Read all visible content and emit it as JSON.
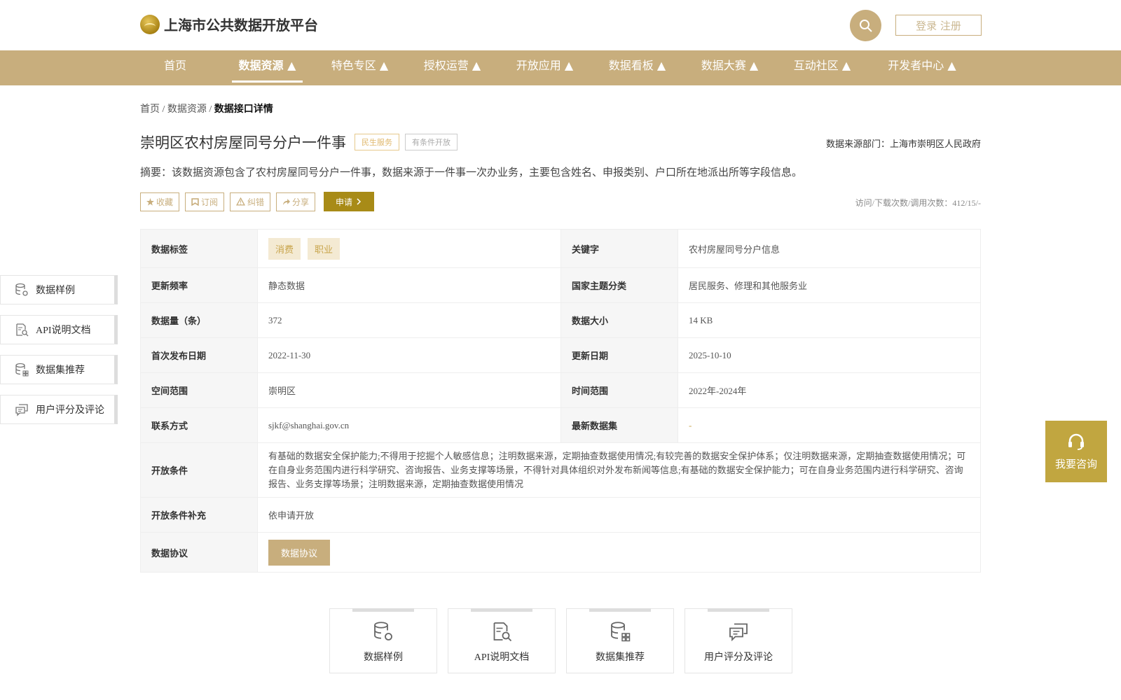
{
  "header": {
    "site_title": "上海市公共数据开放平台",
    "login_label": "登录 注册"
  },
  "nav": {
    "items": [
      {
        "label": "首页"
      },
      {
        "label": "数据资源 ▲"
      },
      {
        "label": "特色专区 ▲"
      },
      {
        "label": "授权运营 ▲"
      },
      {
        "label": "开放应用 ▲"
      },
      {
        "label": "数据看板 ▲"
      },
      {
        "label": "数据大赛 ▲"
      },
      {
        "label": "互动社区 ▲"
      },
      {
        "label": "开发者中心 ▲"
      }
    ],
    "active": "数据资源 ▲"
  },
  "breadcrumb": {
    "home": "首页",
    "sep1": " / ",
    "resources": "数据资源",
    "sep2": " / ",
    "current": "数据接口详情"
  },
  "detail": {
    "title": "崇明区农村房屋同号分户一件事",
    "tag_service": "民生服务",
    "tag_condition": "有条件开放",
    "source": "数据来源部门：上海市崇明区人民政府",
    "abstract": "摘要：该数据资源包含了农村房屋同号分户一件事，数据来源于一件事一次办业务，主要包含姓名、申报类别、户口所在地派出所等字段信息。",
    "actions": {
      "favorite": "收藏",
      "subscribe": "订阅",
      "report": "纠错",
      "share": "分享",
      "apply": "申请"
    },
    "visits": "访问/下载次数/调用次数：412/15/-"
  },
  "sidebar": {
    "items": [
      {
        "label": "数据样例",
        "icon": "database-gear-icon"
      },
      {
        "label": "API说明文档",
        "icon": "document-search-icon"
      },
      {
        "label": "数据集推荐",
        "icon": "database-grid-icon"
      },
      {
        "label": "用户评分及评论",
        "icon": "comment-icon"
      }
    ]
  },
  "info": {
    "tags_label": "数据标签",
    "tags": [
      "消费",
      "职业"
    ],
    "keyword_label": "关键字",
    "keyword": "农村房屋同号分户信息",
    "freq_label": "更新频率",
    "freq": "静态数据",
    "theme_label": "国家主题分类",
    "theme": "居民服务、修理和其他服务业",
    "count_label": "数据量（条）",
    "count": "372",
    "size_label": "数据大小",
    "size": "14 KB",
    "first_pub_label": "首次发布日期",
    "first_pub": "2022-11-30",
    "update_label": "更新日期",
    "update": "2025-10-10",
    "space_label": "空间范围",
    "space": "崇明区",
    "time_label": "时间范围",
    "time": "2022年-2024年",
    "contact_label": "联系方式",
    "contact": "sjkf@shanghai.gov.cn",
    "latest_label": "最新数据集",
    "latest": "-",
    "cond_label": "开放条件",
    "cond": "有基础的数据安全保护能力;不得用于挖掘个人敏感信息；注明数据来源，定期抽查数据使用情况;有较完善的数据安全保护体系；仅注明数据来源，定期抽查数据使用情况；可在自身业务范围内进行科学研究、咨询报告、业务支撑等场景，不得针对具体组织对外发布新闻等信息;有基础的数据安全保护能力；可在自身业务范围内进行科学研究、咨询报告、业务支撑等场景；注明数据来源，定期抽查数据使用情况",
    "cond_extra_label": "开放条件补充",
    "cond_extra": "依申请开放",
    "protocol_label": "数据协议",
    "protocol_btn": "数据协议"
  },
  "consult": {
    "label": "我要咨询"
  },
  "cards": [
    {
      "label": "数据样例"
    },
    {
      "label": "API说明文档"
    },
    {
      "label": "数据集推荐"
    },
    {
      "label": "用户评分及评论"
    }
  ],
  "colors": {
    "brand": "#c8ae7d",
    "apply": "#a88b17",
    "consult": "#c1a640"
  }
}
